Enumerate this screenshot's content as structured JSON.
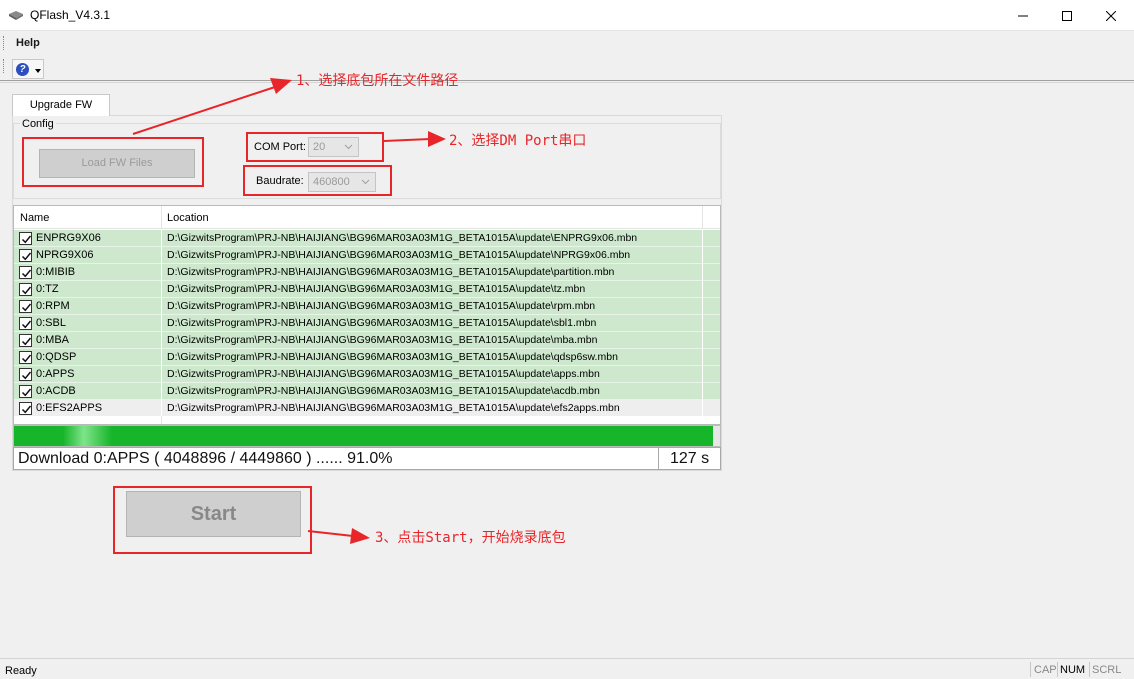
{
  "window": {
    "title": "QFlash_V4.3.1"
  },
  "menu": {
    "help": "Help"
  },
  "tabs": [
    {
      "label": "Upgrade FW"
    }
  ],
  "config": {
    "group_label": "Config",
    "load_button": "Load FW Files",
    "com_port_label": "COM Port:",
    "com_port_value": "20",
    "baudrate_label": "Baudrate:",
    "baudrate_value": "460800"
  },
  "list": {
    "columns": [
      "Name",
      "Location"
    ],
    "rows": [
      {
        "checked": true,
        "name": "ENPRG9X06",
        "location": "D:\\GizwitsProgram\\PRJ-NB\\HAIJIANG\\BG96MAR03A03M1G_BETA1015A\\update\\ENPRG9x06.mbn"
      },
      {
        "checked": true,
        "name": "NPRG9X06",
        "location": "D:\\GizwitsProgram\\PRJ-NB\\HAIJIANG\\BG96MAR03A03M1G_BETA1015A\\update\\NPRG9x06.mbn"
      },
      {
        "checked": true,
        "name": "0:MIBIB",
        "location": "D:\\GizwitsProgram\\PRJ-NB\\HAIJIANG\\BG96MAR03A03M1G_BETA1015A\\update\\partition.mbn"
      },
      {
        "checked": true,
        "name": "0:TZ",
        "location": "D:\\GizwitsProgram\\PRJ-NB\\HAIJIANG\\BG96MAR03A03M1G_BETA1015A\\update\\tz.mbn"
      },
      {
        "checked": true,
        "name": "0:RPM",
        "location": "D:\\GizwitsProgram\\PRJ-NB\\HAIJIANG\\BG96MAR03A03M1G_BETA1015A\\update\\rpm.mbn"
      },
      {
        "checked": true,
        "name": "0:SBL",
        "location": "D:\\GizwitsProgram\\PRJ-NB\\HAIJIANG\\BG96MAR03A03M1G_BETA1015A\\update\\sbl1.mbn"
      },
      {
        "checked": true,
        "name": "0:MBA",
        "location": "D:\\GizwitsProgram\\PRJ-NB\\HAIJIANG\\BG96MAR03A03M1G_BETA1015A\\update\\mba.mbn"
      },
      {
        "checked": true,
        "name": "0:QDSP",
        "location": "D:\\GizwitsProgram\\PRJ-NB\\HAIJIANG\\BG96MAR03A03M1G_BETA1015A\\update\\qdsp6sw.mbn"
      },
      {
        "checked": true,
        "name": "0:APPS",
        "location": "D:\\GizwitsProgram\\PRJ-NB\\HAIJIANG\\BG96MAR03A03M1G_BETA1015A\\update\\apps.mbn"
      },
      {
        "checked": true,
        "name": "0:ACDB",
        "location": "D:\\GizwitsProgram\\PRJ-NB\\HAIJIANG\\BG96MAR03A03M1G_BETA1015A\\update\\acdb.mbn"
      },
      {
        "checked": true,
        "name": "0:EFS2APPS",
        "location": "D:\\GizwitsProgram\\PRJ-NB\\HAIJIANG\\BG96MAR03A03M1G_BETA1015A\\update\\efs2apps.mbn"
      }
    ]
  },
  "progress": {
    "fraction": 0.99,
    "status_text": "Download 0:APPS ( 4048896 / 4449860 ) ...... 91.0%",
    "elapsed": "127 s"
  },
  "start_button": "Start",
  "annotations": {
    "step1": "1、选择底包所在文件路径",
    "step2": "2、选择DM Port串口",
    "step3": "3、点击Start，开始烧录底包",
    "color": "#e8262a"
  },
  "statusbar": {
    "ready": "Ready",
    "cap": "CAP",
    "num": "NUM",
    "scrl": "SCRL"
  }
}
